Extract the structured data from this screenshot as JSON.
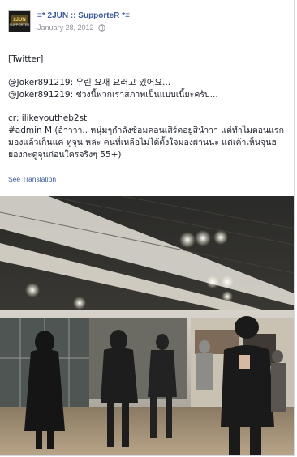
{
  "post": {
    "page_name": "≡* 2JUN :: SupporteR *≡",
    "date": "January 28, 2012",
    "lines": [
      "[Twitter]",
      "@Joker891219: 우린 요새 요러고 있어요...",
      "@Joker891219: ช่วงนี้พวกเราสภาพเป็นแบบเนี้ยะครับ...",
      "cr: ilikeyoutheb2st",
      "#admin M (อ้าาาา.. หนุ่มๆกำลังซ้อมคอนเสิร์ตอยู่สินำาา แต่ทำไมตอนแรกมองแล้วเก็นแค่ ทูจุน หล่ะ คนที่เหลือไม่ได้ตั้งใจมองผ่านนะ แต่เค้าเห็นจุนฮยองกะดูจุนก่อนใครจริงๆ 55+)"
    ],
    "see_translation": "See Translation"
  },
  "icons": {
    "globe": "globe-icon",
    "avatar_text": "2JUN SUPPORTER"
  },
  "colors": {
    "link": "#3b5998",
    "meta": "#90949c",
    "text": "#1d2129"
  }
}
